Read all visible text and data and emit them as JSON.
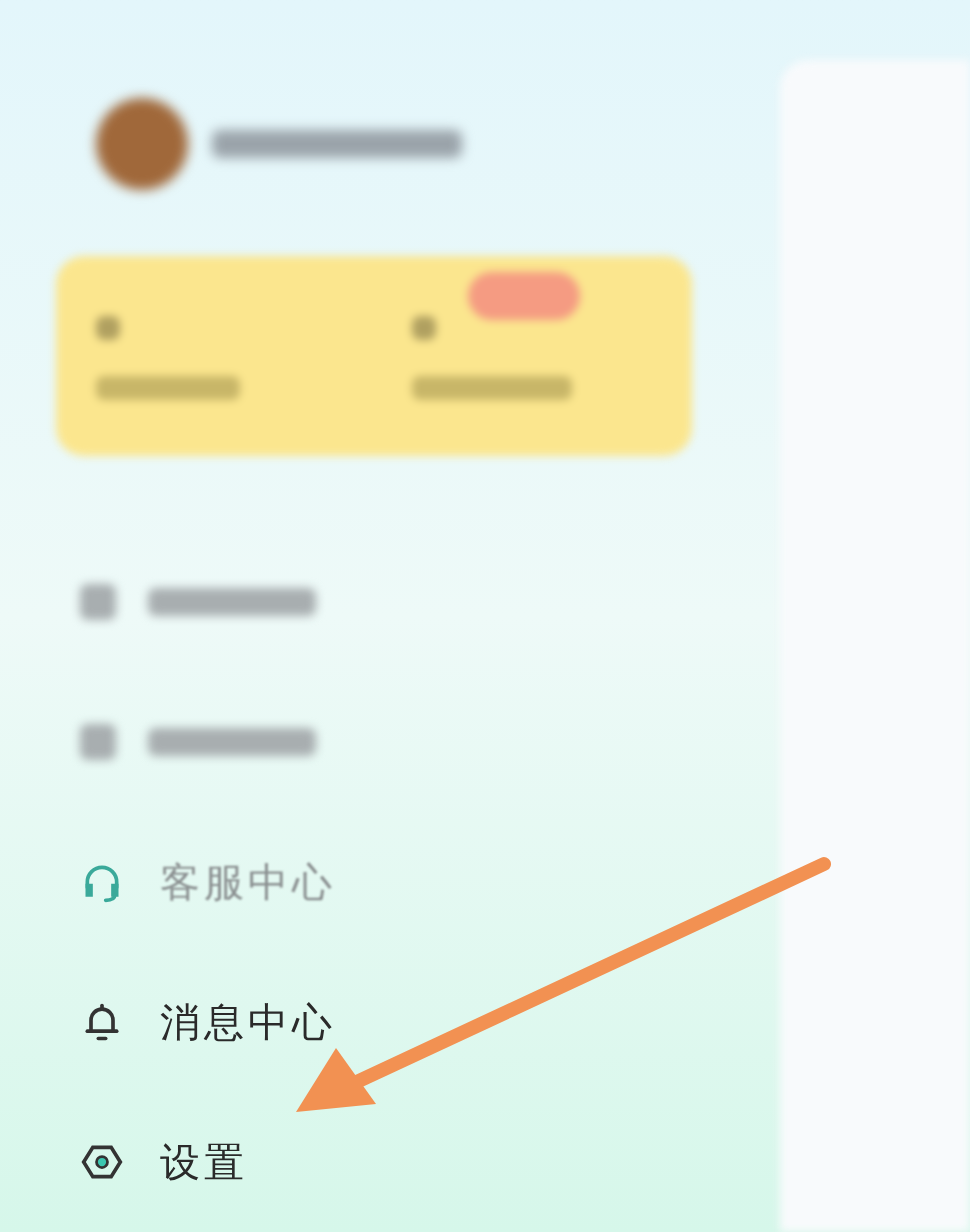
{
  "profile": {
    "kind": "blurred"
  },
  "card": {
    "kind": "blurred"
  },
  "menu": [
    {
      "kind": "blurred"
    },
    {
      "kind": "blurred"
    },
    {
      "kind": "headset",
      "label": "客服中心",
      "faded": true
    },
    {
      "kind": "bell",
      "label": "消息中心",
      "faded": false
    },
    {
      "kind": "gear",
      "label": "设置",
      "faded": false
    }
  ]
}
